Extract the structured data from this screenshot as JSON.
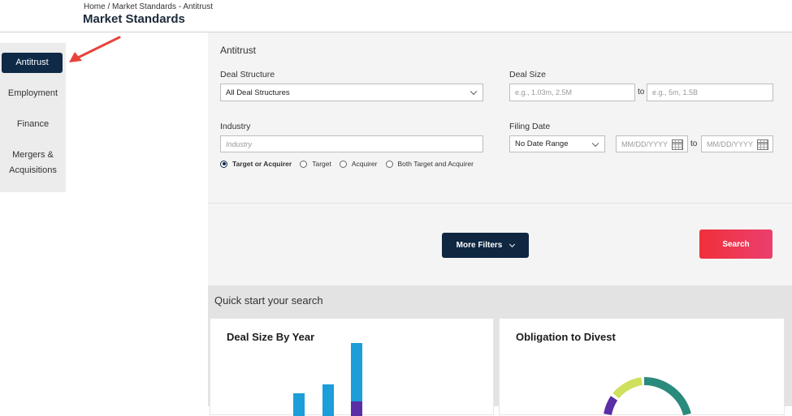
{
  "breadcrumb": {
    "home": "Home",
    "sep1": " / ",
    "section": "Market Standards",
    "sep2": " - ",
    "current": "Antitrust"
  },
  "page_title": "Market Standards",
  "sidebar": {
    "items": [
      {
        "label": "Antitrust",
        "active": true
      },
      {
        "label": "Employment"
      },
      {
        "label": "Finance"
      },
      {
        "label": "Mergers &",
        "label2": "Acquisitions"
      }
    ]
  },
  "form": {
    "section_title": "Antitrust",
    "deal_structure": {
      "label": "Deal Structure",
      "value": "All Deal Structures"
    },
    "deal_size": {
      "label": "Deal Size",
      "min_placeholder": "e.g., 1.03m, 2.5M",
      "to": "to",
      "max_placeholder": "e.g., 5m, 1.5B"
    },
    "industry": {
      "label": "Industry",
      "placeholder": "Industry"
    },
    "filing_date": {
      "label": "Filing Date",
      "range_value": "No Date Range",
      "from_placeholder": "MM/DD/YYYY",
      "to": "to",
      "to_placeholder": "MM/DD/YYYY"
    },
    "radios": [
      {
        "label": "Target or Acquirer",
        "checked": true
      },
      {
        "label": "Target"
      },
      {
        "label": "Acquirer"
      },
      {
        "label": "Both Target and Acquirer"
      }
    ]
  },
  "buttons": {
    "more_filters": "More Filters",
    "search": "Search"
  },
  "quick_start": {
    "title": "Quick start your search",
    "cards": [
      {
        "title": "Deal Size By Year"
      },
      {
        "title": "Obligation to Divest"
      }
    ]
  },
  "colors": {
    "navy": "#0e2a47",
    "search_red": "#f0303a",
    "bar_blue": "#1b9ed9",
    "bar_purple": "#5a2ea6",
    "donut_teal": "#2a8a7c",
    "donut_lime": "#cfe05c",
    "arrow_red": "#e8433b"
  }
}
